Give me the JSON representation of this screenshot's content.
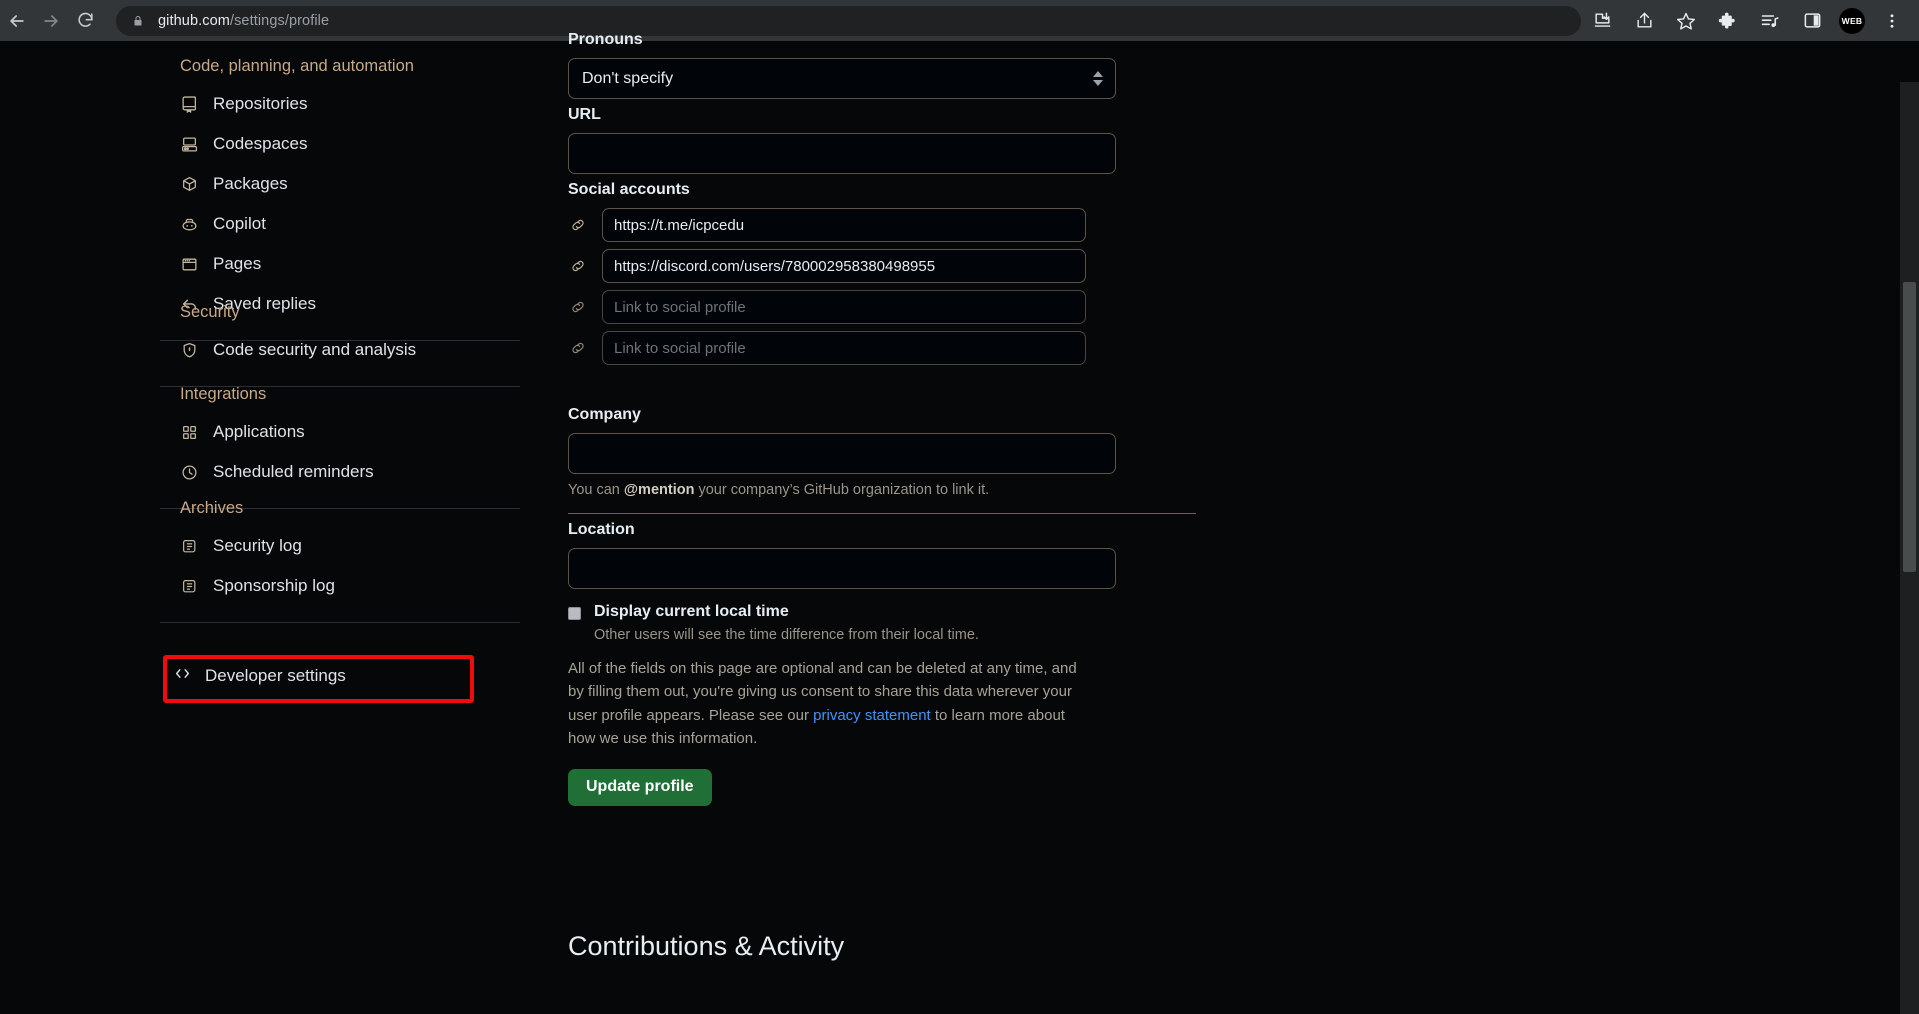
{
  "browser": {
    "back_icon": "arrow-left-icon",
    "forward_icon": "arrow-right-icon",
    "reload_icon": "reload-icon",
    "lock_icon": "lock-icon",
    "url_host": "github.com",
    "url_path": "/settings/profile",
    "actions": [
      {
        "name": "install-app-icon",
        "label": "Install app"
      },
      {
        "name": "share-icon",
        "label": "Share this page"
      },
      {
        "name": "bookmark-star-icon",
        "label": "Bookmark this tab"
      },
      {
        "name": "extensions-puzzle-icon",
        "label": "Extensions"
      },
      {
        "name": "reading-list-icon",
        "label": "Reading list"
      },
      {
        "name": "side-panel-icon",
        "label": "Side panel"
      }
    ],
    "avatar_label": "WEB",
    "menu_icon": "three-dot-menu-icon"
  },
  "sidebar": {
    "groups": [
      {
        "title": "Code, planning, and automation",
        "items": [
          {
            "label": "Repositories",
            "icon": "repo-icon"
          },
          {
            "label": "Codespaces",
            "icon": "codespaces-icon"
          },
          {
            "label": "Packages",
            "icon": "package-icon"
          },
          {
            "label": "Copilot",
            "icon": "copilot-icon"
          },
          {
            "label": "Pages",
            "icon": "browser-window-icon"
          },
          {
            "label": "Saved replies",
            "icon": "reply-arrow-icon"
          }
        ]
      },
      {
        "title": "Security",
        "items": [
          {
            "label": "Code security and analysis",
            "icon": "shield-lock-icon"
          }
        ]
      },
      {
        "title": "Integrations",
        "items": [
          {
            "label": "Applications",
            "icon": "apps-grid-icon"
          },
          {
            "label": "Scheduled reminders",
            "icon": "clock-icon"
          }
        ]
      },
      {
        "title": "Archives",
        "items": [
          {
            "label": "Security log",
            "icon": "log-scroll-icon"
          },
          {
            "label": "Sponsorship log",
            "icon": "log-scroll-icon"
          }
        ]
      }
    ],
    "developer_settings": {
      "label": "Developer settings",
      "icon": "code-brackets-icon",
      "highlight_color": "#f00c0c"
    }
  },
  "main": {
    "pronouns": {
      "label": "Pronouns",
      "value": "Don't specify",
      "stepper_icon": "up-down-stepper-icon"
    },
    "url": {
      "label": "URL",
      "value": "",
      "placeholder": ""
    },
    "social_accounts": {
      "label": "Social accounts",
      "link_icon": "link-chain-icon",
      "rows": [
        {
          "value": "https://t.me/icpcedu",
          "placeholder": "Link to social profile",
          "empty": false
        },
        {
          "value": "https://discord.com/users/780002958380498955",
          "placeholder": "Link to social profile",
          "empty": false
        },
        {
          "value": "",
          "placeholder": "Link to social profile",
          "empty": true
        },
        {
          "value": "",
          "placeholder": "Link to social profile",
          "empty": true
        }
      ]
    },
    "company": {
      "label": "Company",
      "value": "",
      "hint_prefix": "You can ",
      "hint_mention": "@mention",
      "hint_suffix": " your company’s GitHub organization to link it."
    },
    "location": {
      "label": "Location",
      "value": ""
    },
    "local_time": {
      "label": "Display current local time",
      "checked": false,
      "sub": "Other users will see the time difference from their local time."
    },
    "consent": {
      "part1": "All of the fields on this page are optional and can be deleted at any time, and by filling them out, you're giving us consent to share this data wherever your user profile appears. Please see our ",
      "link": "privacy statement",
      "part2": " to learn more about how we use this information."
    },
    "update_button": "Update profile",
    "contributions_heading": "Contributions & Activity"
  },
  "scrollbar": {
    "name": "page-scrollbar"
  }
}
